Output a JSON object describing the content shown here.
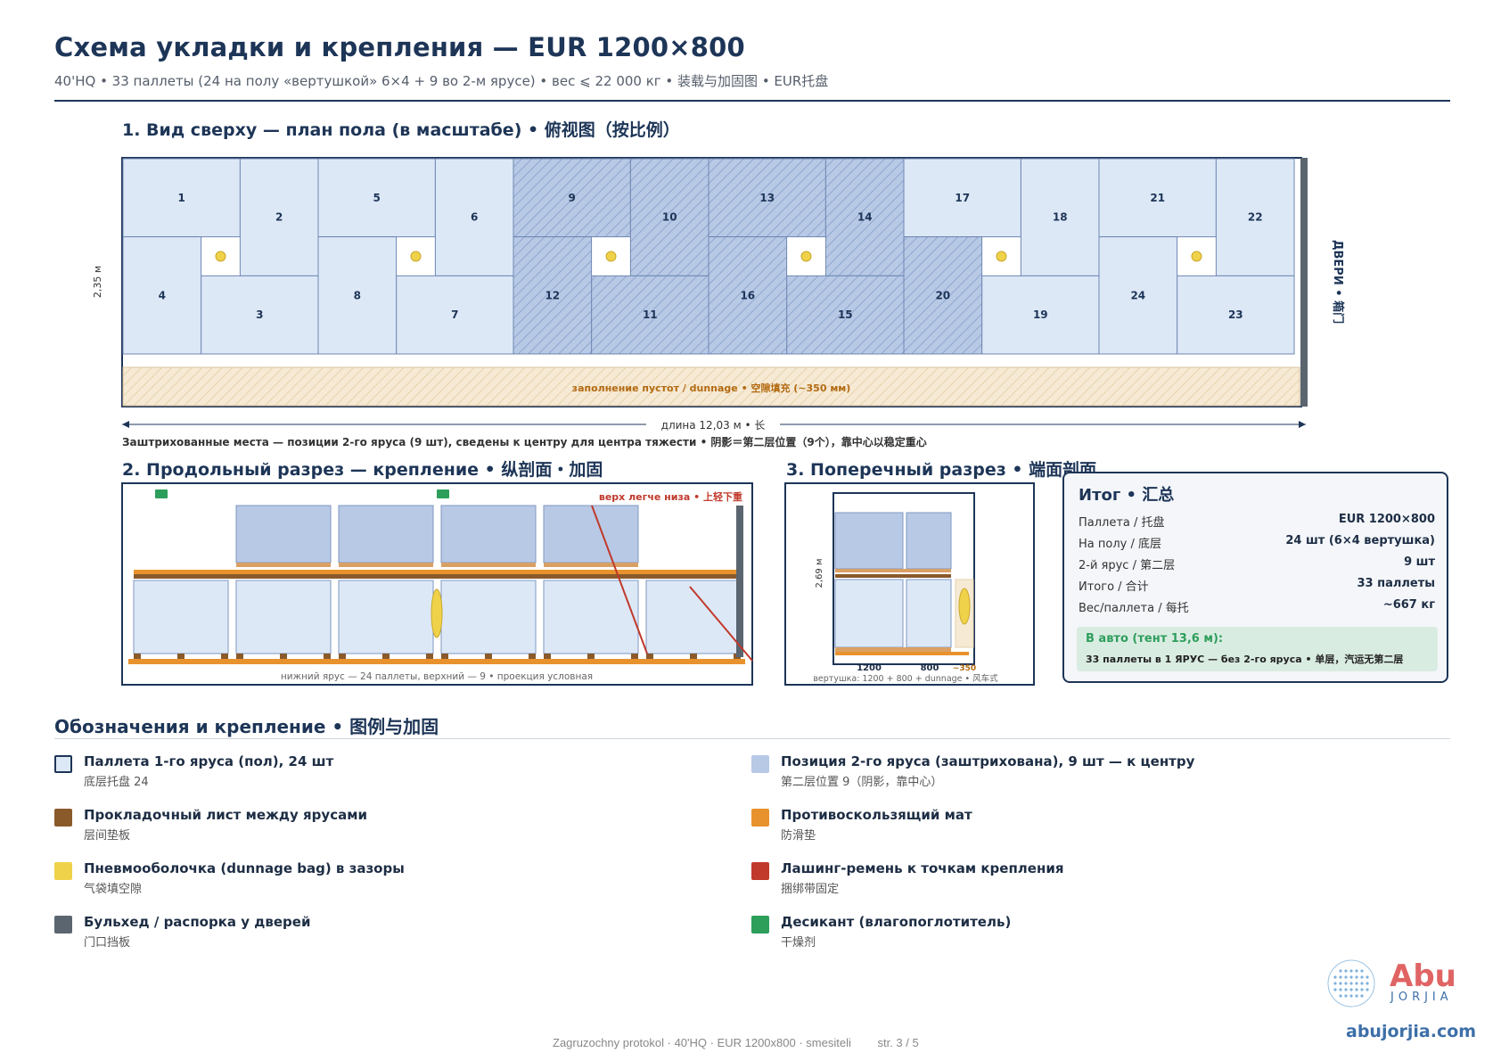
{
  "header": {
    "title": "Схема укладки и крепления — EUR 1200×800",
    "subtitle": "40'HQ • 33 паллеты (24 на полу «вертушкой» 6×4 + 9 во 2-м ярусе) • вес ⩽ 22 000 кг • 装载与加固图 • EUR托盘"
  },
  "top_view": {
    "title": "1. Вид сверху — план пола (в масштабе) • 俯视图（按比例）",
    "width_label": "2,35 м",
    "doors_label": "ДВЕРИ • 箱门",
    "dunnage_label": "заполнение пустот / dunnage • 空隙填充 (~350 мм)",
    "length_label": "длина 12,03 м • 长",
    "pallets": [
      "1",
      "2",
      "3",
      "4",
      "5",
      "6",
      "7",
      "8",
      "9",
      "10",
      "11",
      "12",
      "13",
      "14",
      "15",
      "16",
      "17",
      "18",
      "19",
      "20",
      "21",
      "22",
      "23",
      "24"
    ],
    "note": "Заштрихованные места — позиции 2-го яруса (9 шт), сведены к центру для центра тяжести • 阴影＝第二层位置（9个），靠中心以稳定重心"
  },
  "long_section": {
    "title": "2. Продольный разрез — крепление • 纵剖面・加固",
    "warning": "верх легче низа • 上轻下重",
    "caption": "нижний ярус — 24 паллеты, верхний — 9 • проекция условная"
  },
  "cross_section": {
    "title": "3. Поперечный разрез • 端面剖面",
    "height_label": "2,69 м",
    "dim_1": "1200",
    "dim_2": "800",
    "dim_3": "~350",
    "caption": "вертушка: 1200 + 800 + dunnage • 风车式"
  },
  "summary": {
    "title": "Итог • 汇总",
    "rows": [
      {
        "label": "Паллета / 托盘",
        "value": "EUR 1200×800"
      },
      {
        "label": "На полу / 底层",
        "value": "24 шт (6×4 вертушка)"
      },
      {
        "label": "2-й ярус / 第二层",
        "value": "9 шт"
      },
      {
        "label": "Итого / 合计",
        "value": "33 паллеты"
      },
      {
        "label": "Вес/паллета / 每托",
        "value": "~667 кг"
      }
    ],
    "truck_title": "В авто (тент 13,6 м):",
    "truck_text": "33 паллеты в 1 ЯРУС — без 2-го яруса • 单层，汽运无第二层"
  },
  "legend": {
    "title": "Обозначения и крепление • 图例与加固",
    "items": [
      {
        "label": "Паллета 1-го яруса (пол), 24 шт",
        "sub": "底层托盘 24",
        "color": "#dde8f7"
      },
      {
        "label": "Позиция 2-го яруса (заштрихована), 9 шт — к центру",
        "sub": "第二层位置 9（阴影，靠中心）",
        "color": "#b8c9e6"
      },
      {
        "label": "Прокладочный лист между ярусами",
        "sub": "层间垫板",
        "color": "#8a5a2b"
      },
      {
        "label": "Противоскользящий мат",
        "sub": "防滑垫",
        "color": "#e8922e"
      },
      {
        "label": "Пневмооболочка (dunnage bag) в зазоры",
        "sub": "气袋填空隙",
        "color": "#f0d24a"
      },
      {
        "label": "Лашинг-ремень к точкам крепления",
        "sub": "捆绑带固定",
        "color": "#c0392b"
      },
      {
        "label": "Бульхед / распорка у дверей",
        "sub": "门口挡板",
        "color": "#5a6570"
      },
      {
        "label": "Десикант (влагопоглотитель)",
        "sub": "干燥剂",
        "color": "#2e9e5b"
      }
    ]
  },
  "footer": {
    "text": "Zagruzochny protokol · 40'HQ · EUR 1200x800 · smesiteli",
    "page": "str. 3 / 5"
  },
  "logo": {
    "name": "Abu",
    "sub": "JORJIA",
    "url": "abujorjia.com"
  }
}
